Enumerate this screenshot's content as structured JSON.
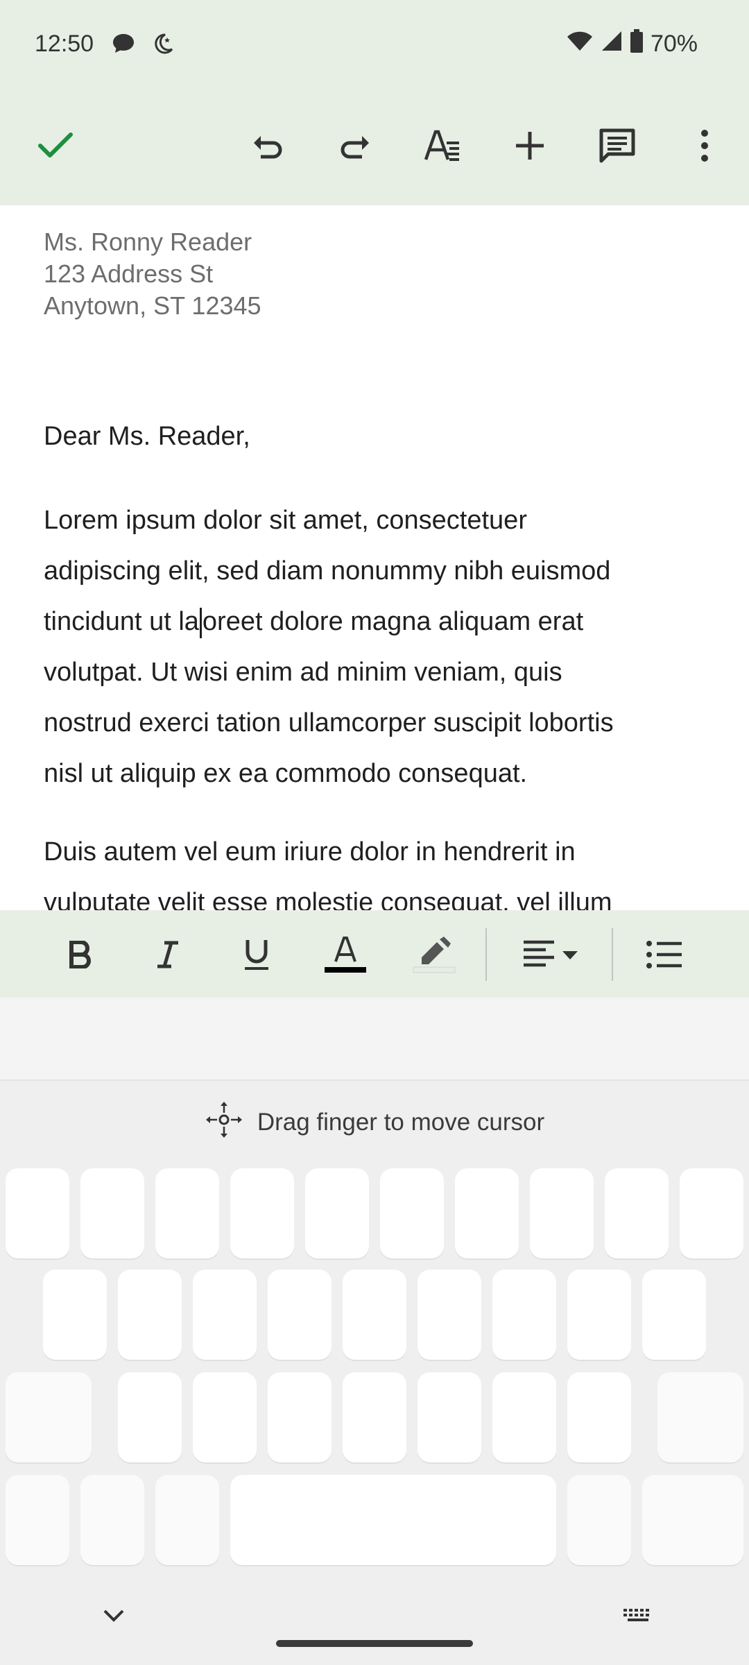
{
  "status_bar": {
    "time": "12:50",
    "icons_left": [
      "chat-bubble-icon",
      "do-not-disturb-moon-icon"
    ],
    "icons_right": [
      "wifi-icon",
      "cellular-signal-icon",
      "battery-icon"
    ],
    "battery_text": "70%"
  },
  "toolbar": {
    "buttons": [
      "check-icon",
      "undo-icon",
      "redo-icon",
      "text-format-icon",
      "insert-plus-icon",
      "comment-icon",
      "more-vert-icon"
    ]
  },
  "document": {
    "address_lines": [
      "Ms. Ronny Reader",
      "123 Address St",
      "Anytown, ST 12345"
    ],
    "greeting": "Dear Ms. Reader,",
    "paragraph1_lines": [
      "Lorem ipsum dolor sit amet, consectetuer",
      "adipiscing elit, sed diam nonummy nibh euismod",
      "tincidunt ut la",
      "oreet dolore magna aliquam erat",
      "volutpat. Ut wisi enim ad minim veniam, quis",
      "nostrud exerci tation ullamcorper suscipit lobortis",
      "nisl ut aliquip ex ea commodo consequat."
    ],
    "paragraph2_lines": [
      "Duis autem vel eum iriure dolor in hendrerit in",
      "vulputate velit esse molestie consequat, vel illum"
    ]
  },
  "format_bar": {
    "buttons": [
      "bold-icon",
      "italic-icon",
      "underline-icon",
      "text-color-icon",
      "highlight-icon",
      "align-left-dropdown-icon",
      "bulleted-list-icon"
    ],
    "text_color": "#000000"
  },
  "keyboard": {
    "hint": "Drag finger to move cursor",
    "hint_icon": "move-cursor-icon",
    "bottom_left_icon": "chevron-down-icon",
    "bottom_right_icon": "keyboard-switch-icon"
  },
  "colors": {
    "accent_green": "#1e8e3e",
    "toolbar_bg": "#e7efe5",
    "keyboard_bg": "#efefef"
  }
}
